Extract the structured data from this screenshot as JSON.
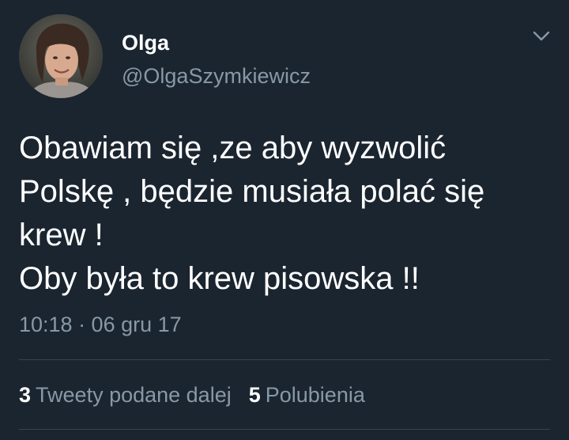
{
  "user": {
    "display_name": "Olga",
    "handle": "@OlgaSzymkiewicz",
    "avatar_icon": "profile-photo"
  },
  "tweet": {
    "lines": [
      "Obawiam się ,ze aby wyzwolić",
      "Polskę , będzie musiała polać się",
      "krew !",
      "Oby była to krew pisowska !!"
    ],
    "timestamp": "10:18 · 06 gru 17"
  },
  "stats": {
    "retweets_count": "3",
    "retweets_label": "Tweety podane dalej",
    "likes_count": "5",
    "likes_label": "Polubienia"
  },
  "menu_icon": "chevron-down-icon",
  "colors": {
    "background": "#1b2530",
    "primary_text": "#ffffff",
    "secondary_text": "#8899a6",
    "divider": "#38444d"
  }
}
